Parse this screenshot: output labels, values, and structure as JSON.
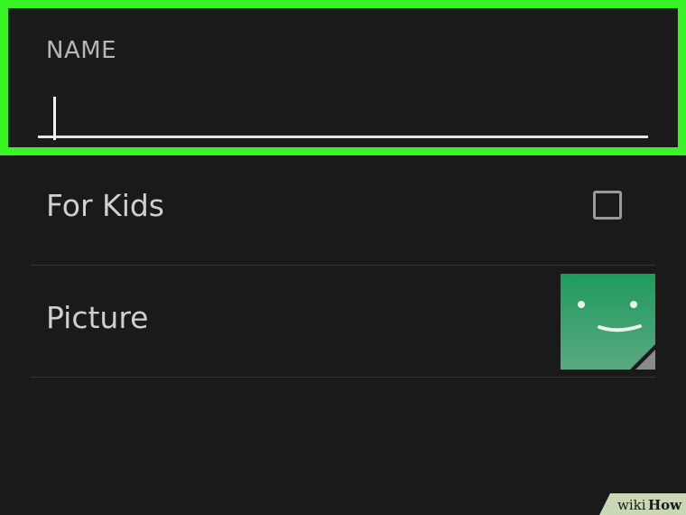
{
  "name_field": {
    "label": "NAME",
    "value": "",
    "placeholder": ""
  },
  "for_kids": {
    "label": "For Kids",
    "checked": false
  },
  "picture": {
    "label": "Picture",
    "avatar_color": "#1f9a5c"
  },
  "highlight_color": "#39f523",
  "watermark": {
    "wiki": "wiki",
    "how": "How"
  }
}
